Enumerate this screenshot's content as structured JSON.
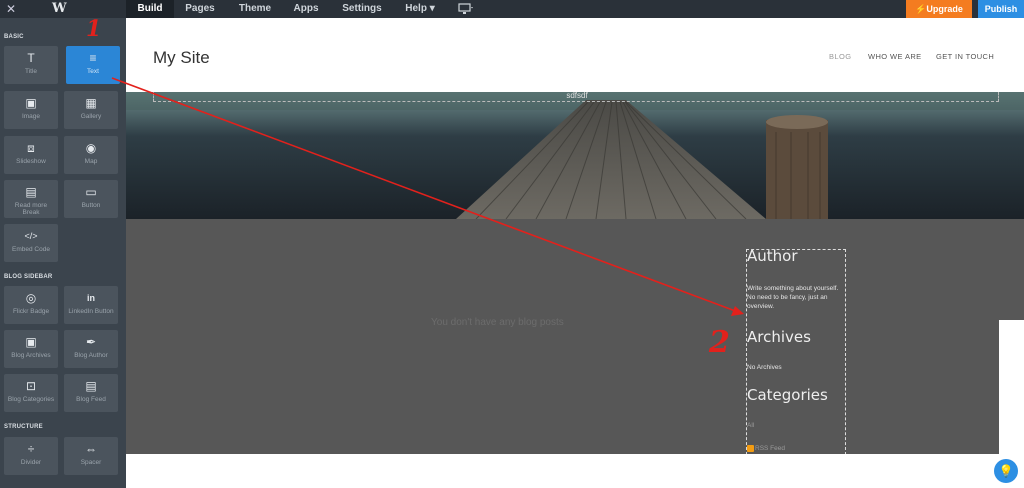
{
  "topbar": {
    "close": "✕",
    "logo": "W",
    "tabs": [
      "Build",
      "Pages",
      "Theme",
      "Apps",
      "Settings",
      "Help ▾"
    ],
    "device_icon": "desktop-icon",
    "upgrade": "⚡Upgrade",
    "publish": "Publish"
  },
  "sidebar": {
    "sections": {
      "basic": "BASIC",
      "blog_sidebar": "BLOG SIDEBAR",
      "structure": "STRUCTURE"
    },
    "basic": [
      {
        "label": "Title",
        "icon": "T"
      },
      {
        "label": "Text",
        "icon": "≡"
      },
      {
        "label": "Image",
        "icon": "▣"
      },
      {
        "label": "Gallery",
        "icon": "▦"
      },
      {
        "label": "Slideshow",
        "icon": "⧈"
      },
      {
        "label": "Map",
        "icon": "◉"
      },
      {
        "label": "Read more Break",
        "icon": "▤"
      },
      {
        "label": "Button",
        "icon": "▭"
      },
      {
        "label": "Embed Code",
        "icon": "</>"
      }
    ],
    "blog": [
      {
        "label": "Flickr Badge",
        "icon": "◎"
      },
      {
        "label": "LinkedIn Button",
        "icon": "in"
      },
      {
        "label": "Blog Archives",
        "icon": "▣"
      },
      {
        "label": "Blog Author",
        "icon": "✒"
      },
      {
        "label": "Blog Categories",
        "icon": "⊡"
      },
      {
        "label": "Blog Feed",
        "icon": "▤"
      }
    ],
    "structure": [
      {
        "label": "Divider",
        "icon": "÷"
      },
      {
        "label": "Spacer",
        "icon": "⇔"
      }
    ]
  },
  "site": {
    "title": "My Site",
    "nav": [
      "BLOG",
      "WHO WE ARE",
      "GET IN TOUCH"
    ],
    "hero_caption": "sdfsdf",
    "empty_message": "You don't have any blog posts",
    "widgets": {
      "author_title": "Author",
      "author_text": "Write something about yourself. No need to be fancy, just an overview.",
      "archives_title": "Archives",
      "archives_text": "No Archives",
      "categories_title": "Categories",
      "categories_text": "All",
      "rss": "RSS Feed"
    }
  },
  "annotations": {
    "one": "1",
    "two": "2"
  },
  "colors": {
    "topbar": "#2a3139",
    "sidebar": "#3b444d",
    "accent": "#2d8fe3",
    "upgrade": "#f47c20",
    "annotation": "#e2211c"
  }
}
